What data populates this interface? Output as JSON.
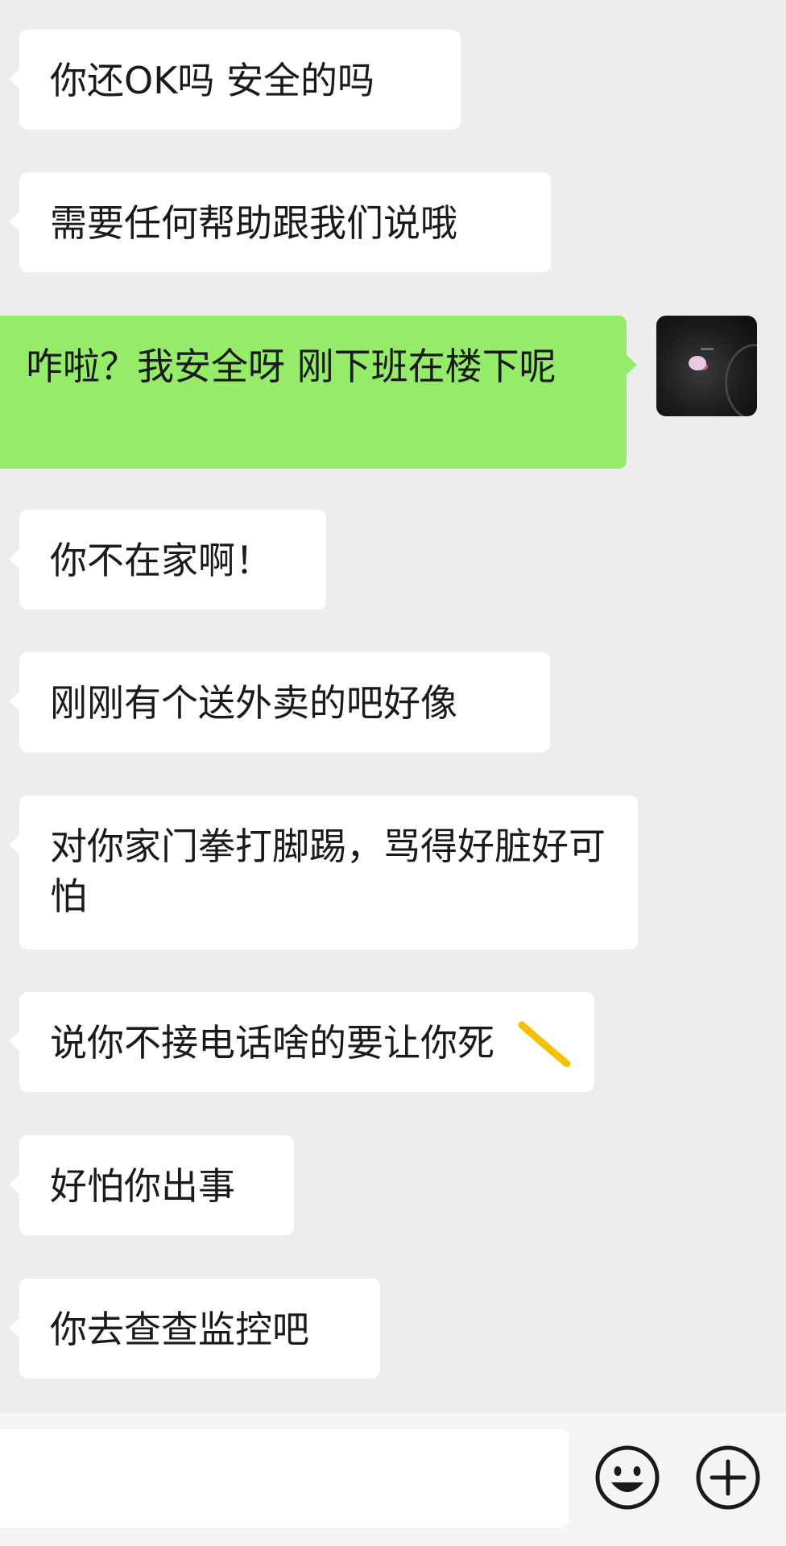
{
  "messages": [
    {
      "side": "in",
      "text": "你还OK吗 安全的吗"
    },
    {
      "side": "in",
      "text": "需要任何帮助跟我们说哦"
    },
    {
      "side": "out",
      "text": "咋啦？我安全呀 刚下班在楼下呢"
    },
    {
      "side": "in",
      "text": "你不在家啊！"
    },
    {
      "side": "in",
      "text": "刚刚有个送外卖的吧好像"
    },
    {
      "side": "in",
      "text": "对你家门拳打脚踢，骂得好脏好可怕"
    },
    {
      "side": "in",
      "text": "说你不接电话啥的要让你死"
    },
    {
      "side": "in",
      "text": "好怕你出事"
    },
    {
      "side": "in",
      "text": "你去查查监控吧"
    }
  ],
  "input_bar": {
    "input_value": "",
    "emoji_icon": "smiley-face-icon",
    "plus_icon": "plus-circle-icon"
  },
  "colors": {
    "background": "#ededed",
    "incoming_bubble": "#ffffff",
    "outgoing_bubble": "#95ec69",
    "highlight_scribble": "#f2c200"
  }
}
